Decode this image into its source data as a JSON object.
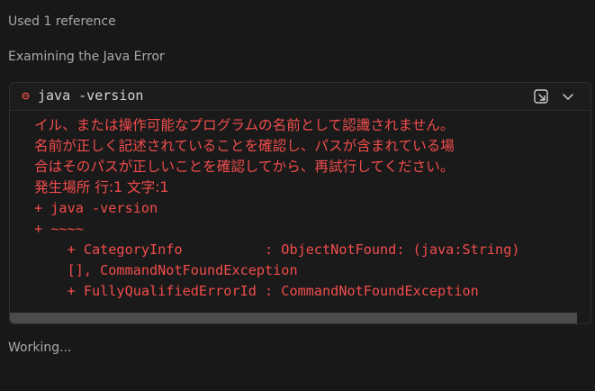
{
  "chat": {
    "used_reference": "Used 1 reference",
    "step_title": "Examining the Java Error",
    "working_status": "Working..."
  },
  "terminal": {
    "command": "java -version",
    "status_icon": "error-circle-icon",
    "status_color": "#f14c4c",
    "actions": [
      "open-in-terminal-icon",
      "chevron-down-icon"
    ],
    "output_lines": [
      "イル、または操作可能なプログラムの名前として認識されません。",
      "名前が正しく記述されていることを確認し、パスが含まれている場",
      "合はそのパスが正しいことを確認してから、再試行してください。",
      "発生場所 行:1 文字:1",
      "+ java -version",
      "+ ~~~~",
      "    + CategoryInfo          : ObjectNotFound: (java:String)",
      "    [], CommandNotFoundException",
      "    + FullyQualifiedErrorId : CommandNotFoundException"
    ]
  }
}
